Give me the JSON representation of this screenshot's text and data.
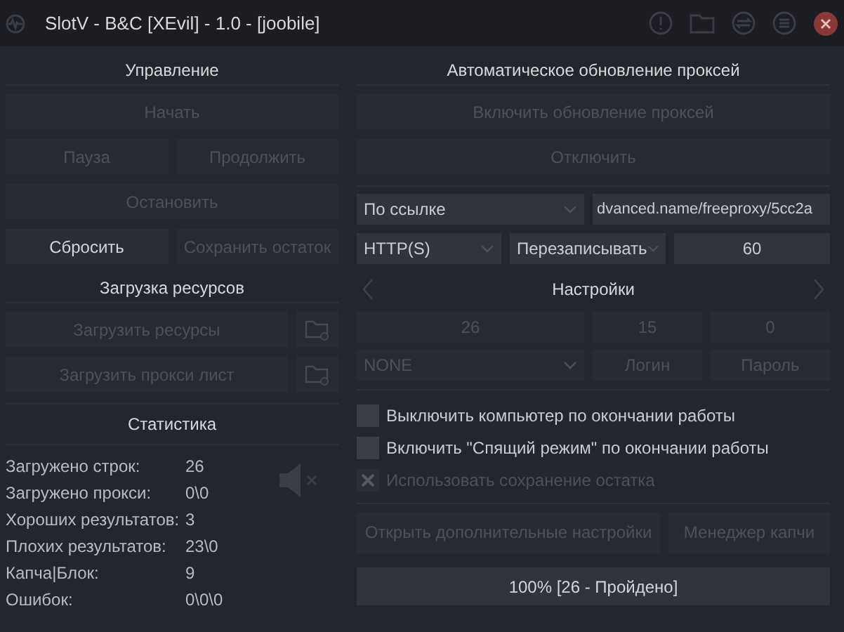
{
  "window": {
    "title": "SlotV - B&C [XEvil] - 1.0 - [joobile]"
  },
  "control": {
    "title": "Управление",
    "rows": [
      [
        {
          "label": "Начать",
          "disabled": true
        }
      ],
      [
        {
          "label": "Пауза",
          "disabled": true
        },
        {
          "label": "Продолжить",
          "disabled": true
        }
      ],
      [
        {
          "label": "Остановить",
          "disabled": true
        }
      ],
      [
        {
          "label": "Сбросить",
          "disabled": false
        },
        {
          "label": "Сохранить остаток",
          "disabled": true
        }
      ]
    ]
  },
  "resources": {
    "title": "Загрузка ресурсов",
    "rows": [
      {
        "label": "Загрузить ресурсы",
        "disabled": true
      },
      {
        "label": "Загрузить прокси лист",
        "disabled": true
      }
    ]
  },
  "stats": {
    "title": "Статистика",
    "rows": [
      {
        "label": "Загружено строк:",
        "value": "26"
      },
      {
        "label": "Загружено прокси:",
        "value": "0\\0"
      },
      {
        "label": "Хороших результатов:",
        "value": "3"
      },
      {
        "label": "Плохих результатов:",
        "value": "23\\0"
      },
      {
        "label": "Капча|Блок:",
        "value": "9"
      },
      {
        "label": "Ошибок:",
        "value": "0\\0\\0"
      }
    ]
  },
  "proxy_update": {
    "title": "Автоматическое обновление проксей",
    "buttons": [
      {
        "label": "Включить обновление проксей",
        "disabled": true
      },
      {
        "label": "Отключить",
        "disabled": true
      }
    ],
    "source": "По ссылке",
    "url": "dvanced.name/freeproxy/5cc2a",
    "protocol": "HTTP(S)",
    "mode": "Перезаписывать",
    "interval": "60"
  },
  "settings": {
    "title": "Настройки",
    "fields": [
      {
        "value": "26",
        "disabled": true
      },
      {
        "value": "15",
        "disabled": true
      },
      {
        "value": "0",
        "disabled": true
      }
    ],
    "proxy_type": {
      "value": "NONE",
      "disabled": true
    },
    "login": {
      "placeholder": "Логин"
    },
    "password": {
      "placeholder": "Пароль"
    }
  },
  "options": [
    {
      "label": "Выключить компьютер по окончании работы",
      "checked": false,
      "disabled": false
    },
    {
      "label": "Включить \"Спящий режим\" по окончании работы",
      "checked": false,
      "disabled": false
    },
    {
      "label": "Использовать сохранение остатка",
      "checked": true,
      "disabled": true
    }
  ],
  "buttons": [
    {
      "label": "Открыть дополнительные настройки",
      "disabled": true
    },
    {
      "label": "Менеджер капчи",
      "disabled": true
    }
  ],
  "progress": {
    "level": 1,
    "text": "100% [26 - Пройдено]"
  }
}
